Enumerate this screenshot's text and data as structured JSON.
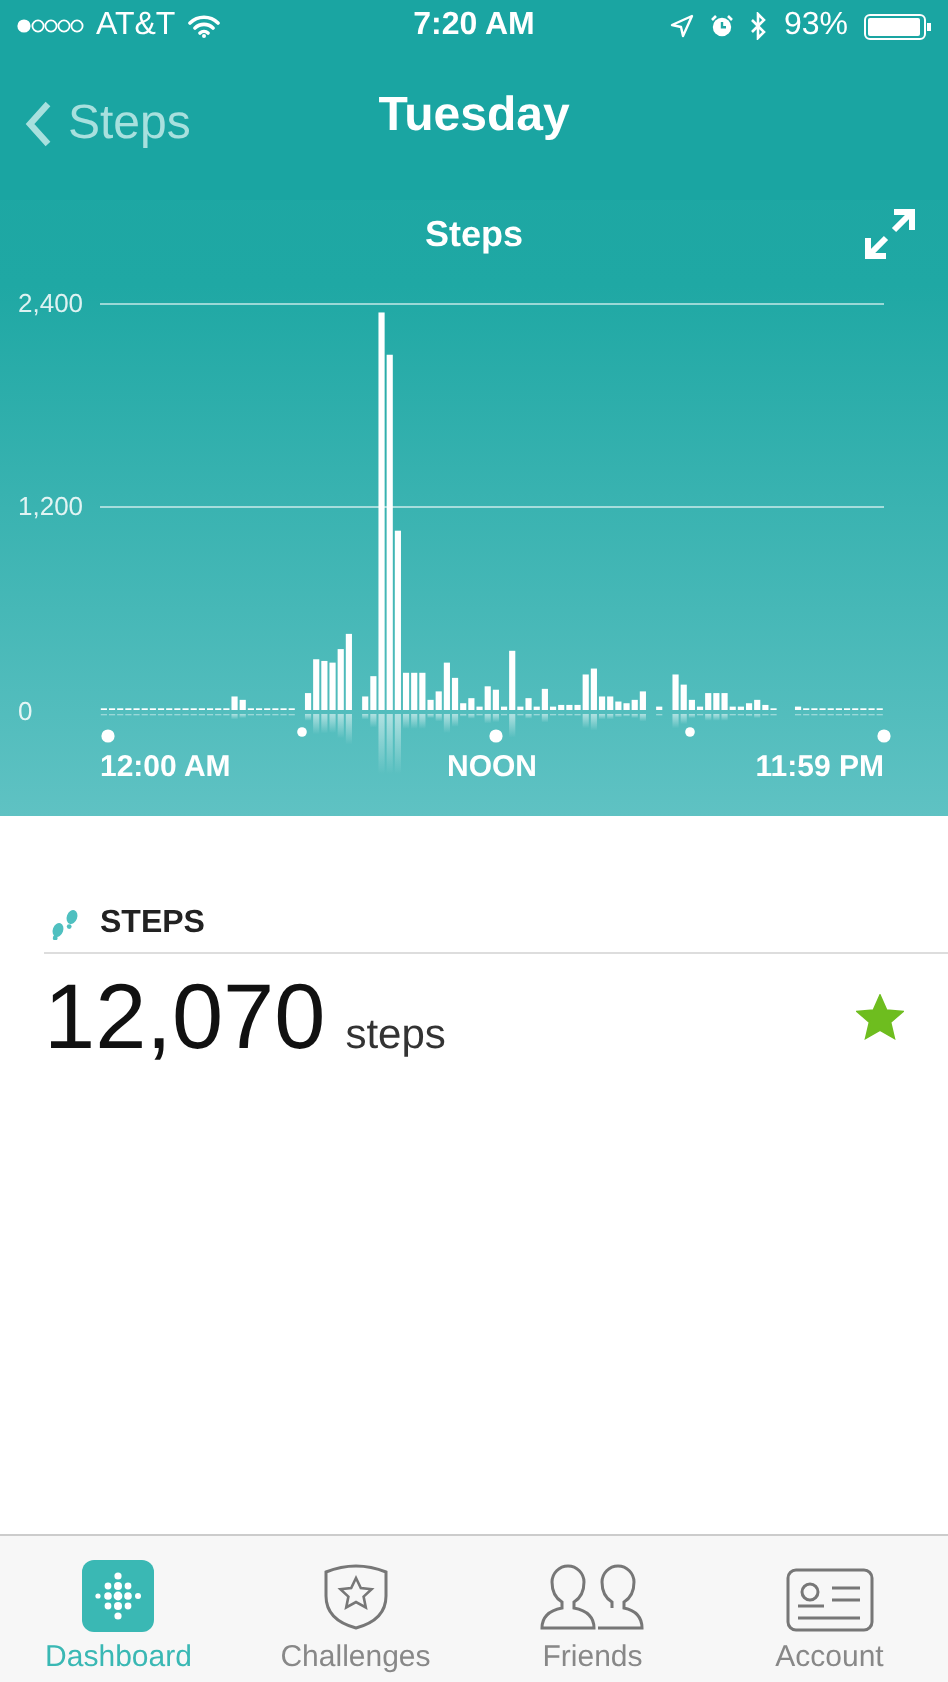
{
  "status_bar": {
    "carrier": "AT&T",
    "time": "7:20 AM",
    "battery": "93%"
  },
  "nav": {
    "back": "Steps",
    "title": "Tuesday"
  },
  "chart": {
    "title": "Steps",
    "x_labels": [
      "12:00 AM",
      "NOON",
      "11:59 PM"
    ],
    "chart_data": {
      "type": "bar",
      "yticks": [
        {
          "value": 0,
          "label": "0"
        },
        {
          "value": 1200,
          "label": "1,200"
        },
        {
          "value": 2400,
          "label": "2,400"
        }
      ],
      "ylim": [
        0,
        2400
      ],
      "values": [
        10,
        10,
        10,
        10,
        10,
        10,
        10,
        10,
        10,
        10,
        10,
        10,
        10,
        10,
        10,
        10,
        80,
        60,
        10,
        10,
        10,
        10,
        10,
        10,
        0,
        100,
        300,
        290,
        280,
        360,
        450,
        0,
        80,
        200,
        2350,
        2100,
        1060,
        220,
        220,
        220,
        60,
        110,
        280,
        190,
        40,
        70,
        20,
        140,
        120,
        20,
        350,
        20,
        70,
        20,
        125,
        20,
        30,
        30,
        30,
        210,
        245,
        80,
        80,
        50,
        40,
        60,
        110,
        0,
        20,
        0,
        210,
        150,
        60,
        20,
        100,
        100,
        100,
        20,
        20,
        40,
        60,
        30,
        10,
        0,
        0,
        20,
        10,
        10,
        10,
        10,
        10,
        10,
        10,
        10,
        10,
        10
      ]
    }
  },
  "summary": {
    "heading": "STEPS",
    "value": "12,070",
    "unit": "steps",
    "goal_met": true
  },
  "tab_bar": [
    {
      "kind": "dashboard",
      "label": "Dashboard",
      "selected": true
    },
    {
      "kind": "challenges",
      "label": "Challenges",
      "selected": false
    },
    {
      "kind": "friends",
      "label": "Friends",
      "selected": false
    },
    {
      "kind": "account",
      "label": "Account",
      "selected": false
    }
  ]
}
